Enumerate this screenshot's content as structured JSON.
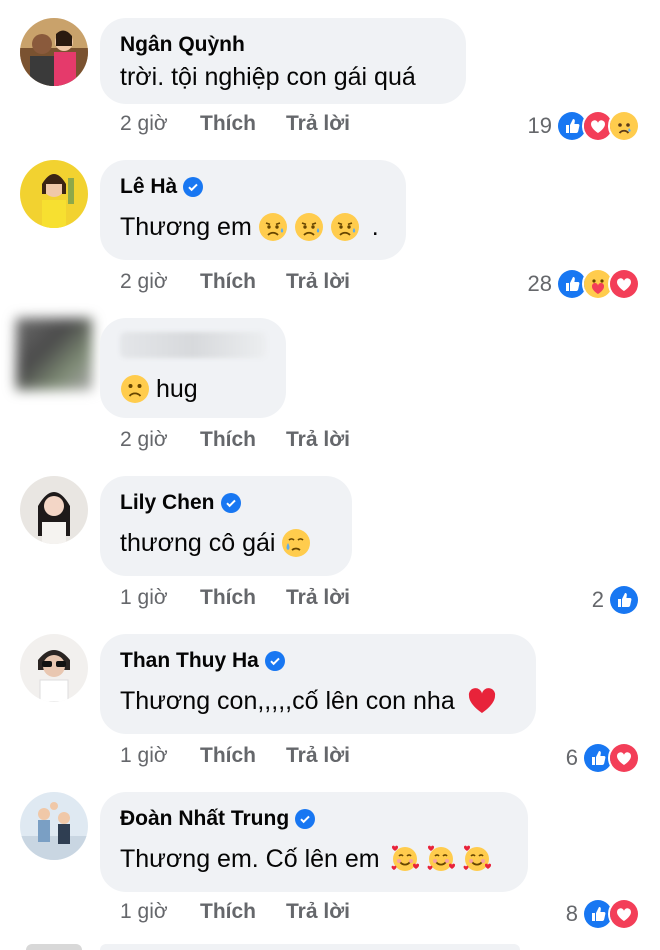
{
  "comments": [
    {
      "name": "Ngân Quỳnh",
      "verified": false,
      "text": "trời. tội nghiệp con gái quá",
      "emojis": [],
      "time": "2 giờ",
      "like_label": "Thích",
      "reply_label": "Trả lời",
      "reaction_count": "19",
      "reactions": [
        "like-icon",
        "love-icon",
        "sad-icon"
      ]
    },
    {
      "name": "Lê Hà",
      "verified": true,
      "text": "Thương em",
      "emojis": [
        "sad-sweat-emoji",
        "sad-sweat-emoji",
        "sad-sweat-emoji"
      ],
      "text_suffix": ".",
      "time": "2 giờ",
      "like_label": "Thích",
      "reply_label": "Trả lời",
      "reaction_count": "28",
      "reactions": [
        "like-icon",
        "care-icon",
        "love-icon"
      ]
    },
    {
      "name": "",
      "verified": false,
      "text": "hug",
      "emojis": [
        "frown-emoji"
      ],
      "time": "2 giờ",
      "like_label": "Thích",
      "reply_label": "Trả lời",
      "reaction_count": "",
      "reactions": []
    },
    {
      "name": "Lily Chen",
      "verified": true,
      "text": "thương cô gái",
      "emojis": [
        "crying-emoji"
      ],
      "time": "1 giờ",
      "like_label": "Thích",
      "reply_label": "Trả lời",
      "reaction_count": "2",
      "reactions": [
        "like-icon"
      ]
    },
    {
      "name": "Than Thuy Ha",
      "verified": true,
      "text": "Thương con,,,,,cố lên con nha",
      "emojis": [
        "red-heart-emoji"
      ],
      "time": "1 giờ",
      "like_label": "Thích",
      "reply_label": "Trả lời",
      "reaction_count": "6",
      "reactions": [
        "like-icon",
        "love-icon"
      ]
    },
    {
      "name": "Đoàn Nhất Trung",
      "verified": true,
      "text": "Thương em. Cố lên em",
      "emojis": [
        "hearts-face-emoji",
        "hearts-face-emoji",
        "hearts-face-emoji"
      ],
      "time": "1 giờ",
      "like_label": "Thích",
      "reply_label": "Trả lời",
      "reaction_count": "8",
      "reactions": [
        "like-icon",
        "love-icon"
      ]
    }
  ],
  "colors": {
    "bubble": "#f0f2f5",
    "muted_text": "#65676b",
    "like_blue": "#1877f2",
    "love_red": "#f33e58",
    "emoji_yellow": "#ffcc4d"
  }
}
